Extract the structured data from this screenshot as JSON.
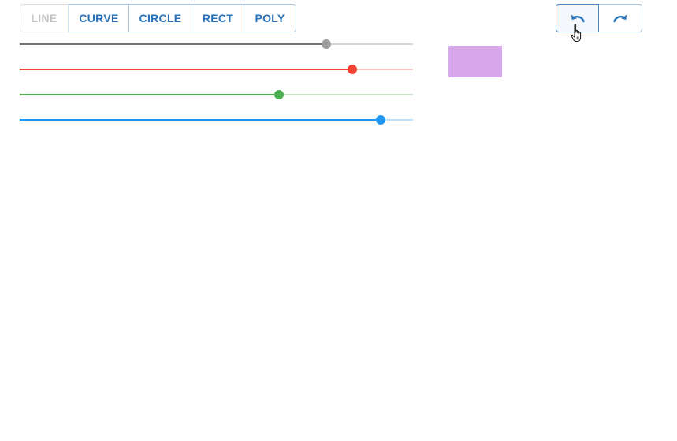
{
  "toolbar": {
    "tools": [
      {
        "label": "LINE",
        "state": "disabled"
      },
      {
        "label": "CURVE",
        "state": "enabled"
      },
      {
        "label": "CIRCLE",
        "state": "enabled"
      },
      {
        "label": "RECT",
        "state": "enabled"
      },
      {
        "label": "POLY",
        "state": "enabled"
      }
    ]
  },
  "history": {
    "undo_icon": "undo-icon",
    "redo_icon": "redo-icon"
  },
  "sliders": [
    {
      "name": "alpha",
      "value": 0.78,
      "fill_color": "#757575",
      "track_color": "#d6d6d6",
      "thumb_color": "#9e9e9e"
    },
    {
      "name": "red",
      "value": 0.845,
      "fill_color": "#f44336",
      "track_color": "#fbc4c0",
      "thumb_color": "#f44336"
    },
    {
      "name": "green",
      "value": 0.66,
      "fill_color": "#4caf50",
      "track_color": "#c4e4c5",
      "thumb_color": "#4caf50"
    },
    {
      "name": "blue",
      "value": 0.918,
      "fill_color": "#2196f3",
      "track_color": "#bcdffb",
      "thumb_color": "#2196f3"
    }
  ],
  "preview": {
    "color": "#d7a9ec"
  }
}
